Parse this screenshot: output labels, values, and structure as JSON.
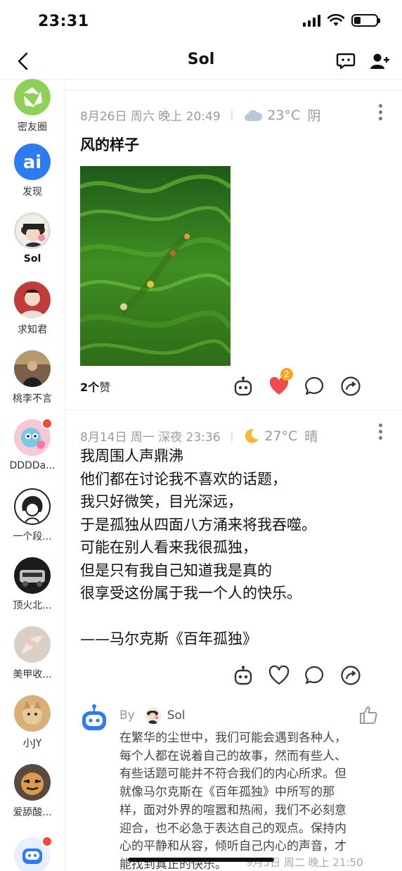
{
  "status_bar": {
    "time": "23:31"
  },
  "nav": {
    "title": "Sol"
  },
  "sidebar": {
    "items": [
      {
        "label": "密友圈",
        "bold": false
      },
      {
        "label": "发现",
        "bold": false
      },
      {
        "label": "Sol",
        "bold": true
      },
      {
        "label": "求知君",
        "bold": false
      },
      {
        "label": "桃李不言",
        "bold": false
      },
      {
        "label": "DDDDa...",
        "bold": false
      },
      {
        "label": "一个段...",
        "bold": false
      },
      {
        "label": "顶火北...",
        "bold": false
      },
      {
        "label": "美甲收...",
        "bold": false
      },
      {
        "label": "小JY",
        "bold": false
      },
      {
        "label": "爱舔酸...",
        "bold": false
      },
      {
        "label": "",
        "bold": false
      }
    ]
  },
  "posts": [
    {
      "date": "8月26日 周六 晚上 20:49",
      "weather_icon": "cloud-icon",
      "temperature": "23°C",
      "weather": "阴",
      "title": "风的样子",
      "likes_count": "2个",
      "likes_suffix": "赞",
      "heart_badge": "2"
    },
    {
      "date": "8月14日 周一 深夜 23:36",
      "weather_icon": "moon-icon",
      "temperature": "27°C",
      "weather": "晴",
      "lines": [
        "我周围人声鼎沸",
        "他们都在讨论我不喜欢的话题，",
        "我只好微笑，目光深远，",
        "于是孤独从四面八方涌来将我吞噬。",
        "可能在别人看来我很孤独，",
        "但是只有我自己知道我是真的",
        "很享受这份属于我一个人的快乐。",
        "",
        "——马尔克斯《百年孤独》"
      ],
      "comment": {
        "by_label": "By",
        "author": "Sol",
        "lines": [
          "在繁华的尘世中，我们可能会遇到各种人，",
          "每个人都在说着自己的故事，然而有些人、",
          "有些话题可能并不符合我们的内心所求。但",
          "就像马尔克斯在《百年孤独》中所写的那",
          "样，面对外界的喧嚣和热闹，我们不必刻意",
          "迎合，也不必急于表达自己的观点。保持内",
          "心的平静和从容，倾听自己内心的声音，才",
          "能找到真正的快乐。"
        ],
        "date": "9月5日 周二 晚上 21:50"
      }
    }
  ],
  "colors": {
    "accent_red": "#f04a3a",
    "badge_orange": "#f5a623",
    "heart_red": "#f04a4a",
    "ai_blue": "#2d7bf0"
  }
}
